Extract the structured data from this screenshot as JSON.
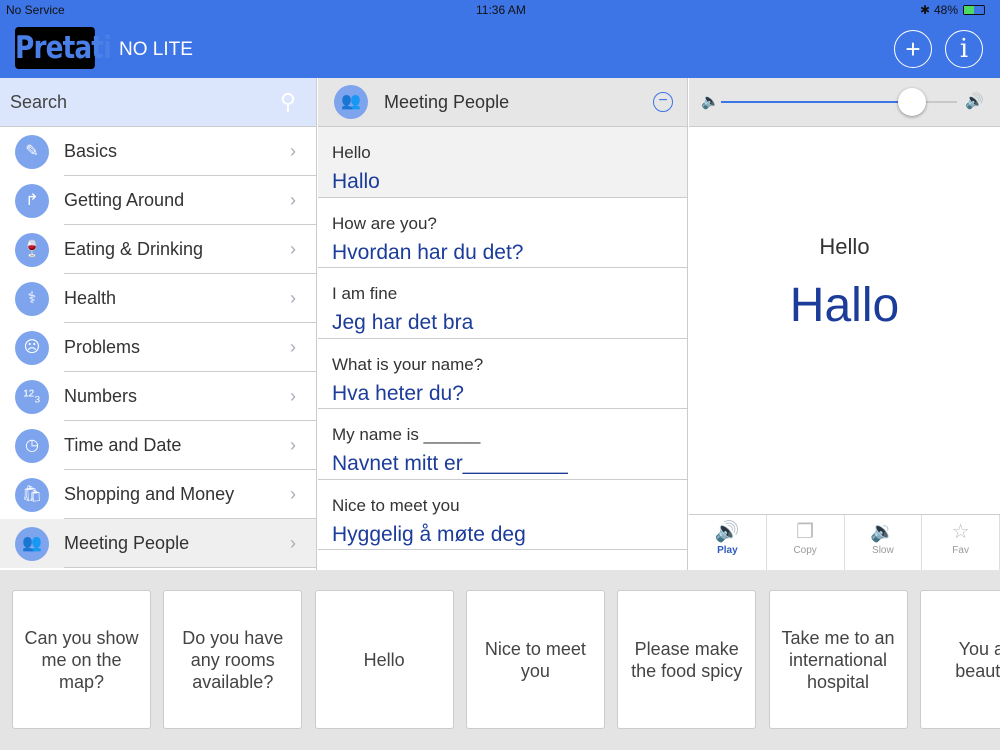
{
  "status": {
    "carrier": "No Service",
    "time": "11:36 AM",
    "battery": "48%"
  },
  "header": {
    "logo": "Pretati",
    "title": "NO LITE",
    "add_icon": "+",
    "info_icon": "i"
  },
  "search": {
    "placeholder": "Search"
  },
  "categories": [
    {
      "label": "Basics",
      "icon": "✎"
    },
    {
      "label": "Getting Around",
      "icon": "↱"
    },
    {
      "label": "Eating & Drinking",
      "icon": "🍷"
    },
    {
      "label": "Health",
      "icon": "⚕"
    },
    {
      "label": "Problems",
      "icon": "☹"
    },
    {
      "label": "Numbers",
      "icon": "¹²₃"
    },
    {
      "label": "Time and Date",
      "icon": "◷"
    },
    {
      "label": "Shopping and Money",
      "icon": "🛍"
    },
    {
      "label": "Meeting People",
      "icon": "👥"
    }
  ],
  "middle": {
    "title": "Meeting People",
    "phrases": [
      {
        "en": "Hello",
        "no": "Hallo"
      },
      {
        "en": "How are you?",
        "no": "Hvordan har du det?"
      },
      {
        "en": "I am fine",
        "no": "Jeg har det bra"
      },
      {
        "en": "What is your name?",
        "no": "Hva heter du?"
      },
      {
        "en": "My name is ______",
        "no": "Navnet mitt er_________"
      },
      {
        "en": "Nice to meet you",
        "no": "Hyggelig å møte deg"
      }
    ]
  },
  "detail": {
    "en": "Hello",
    "no": "Hallo",
    "volume": 0.81,
    "actions": [
      {
        "label": "Play",
        "icon": "🔊"
      },
      {
        "label": "Copy",
        "icon": "❐"
      },
      {
        "label": "Slow",
        "icon": "🔉"
      },
      {
        "label": "Fav",
        "icon": "☆"
      }
    ]
  },
  "tray": [
    "Can you show me on the map?",
    "Do you have any rooms available?",
    "Hello",
    "Nice to meet you",
    "Please make the food spicy",
    "Take me to an international hospital",
    "You are beautiful"
  ],
  "colors": {
    "accent": "#3d74e6",
    "norwegian": "#1c3c9a"
  }
}
